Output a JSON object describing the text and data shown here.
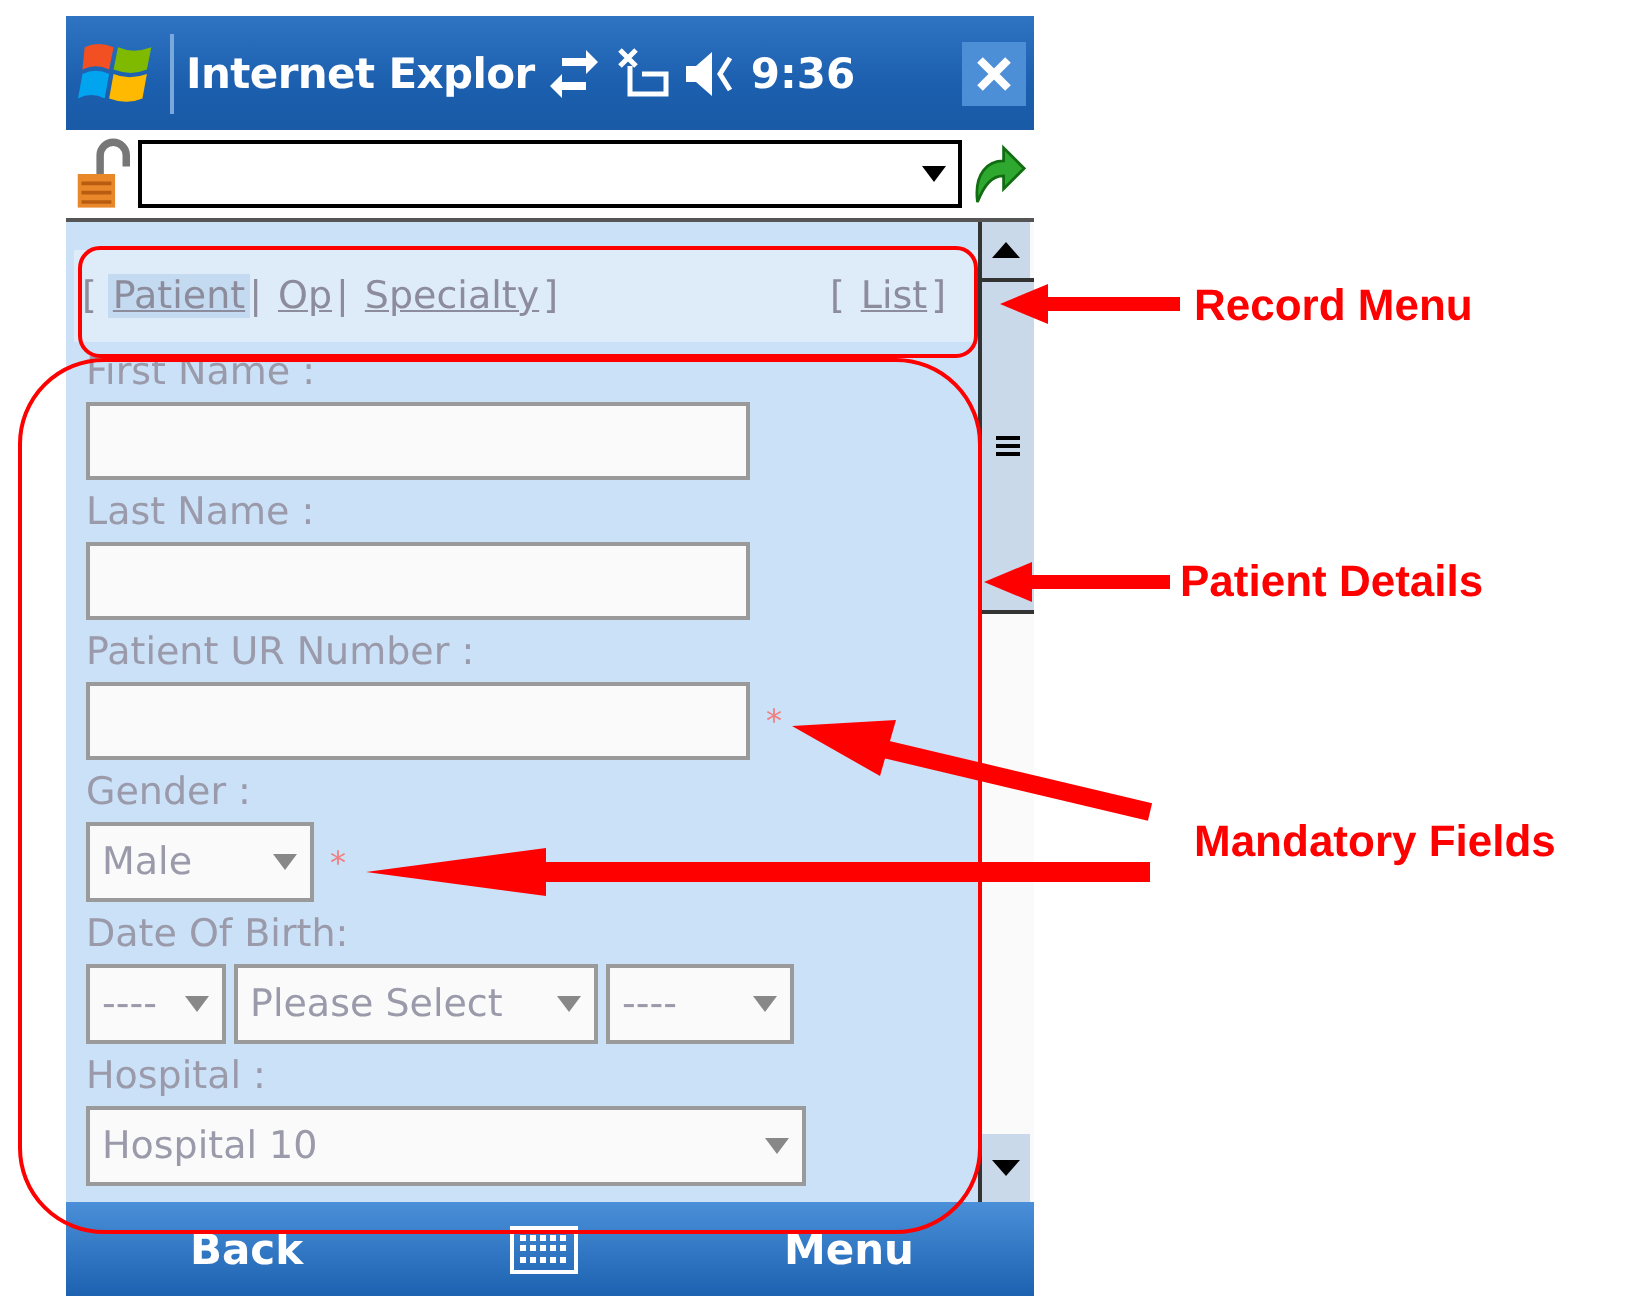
{
  "title_bar": {
    "title": "Internet Explor",
    "time": "9:36"
  },
  "record_menu": {
    "tabs": [
      {
        "text": "[",
        "kind": "mark"
      },
      {
        "text": "Patient",
        "kind": "link",
        "selected": true
      },
      {
        "text": "|",
        "kind": "mark"
      },
      {
        "text": "Op",
        "kind": "link",
        "selected": false
      },
      {
        "text": "|",
        "kind": "mark"
      },
      {
        "text": "Specialty",
        "kind": "link",
        "selected": false
      },
      {
        "text": "]",
        "kind": "mark"
      }
    ],
    "list": [
      {
        "text": "[",
        "kind": "mark"
      },
      {
        "text": "List",
        "kind": "link",
        "selected": false
      },
      {
        "text": "]",
        "kind": "mark"
      }
    ]
  },
  "fields": [
    {
      "label": "First Name :",
      "kind": "text"
    },
    {
      "label": "Last Name :",
      "kind": "text"
    },
    {
      "label": "Patient UR Number :",
      "kind": "text",
      "required_mark": "*"
    },
    {
      "label": "Gender :",
      "kind": "select",
      "required_mark": "*",
      "selects": [
        {
          "value": "Male"
        }
      ]
    },
    {
      "label": "Date Of Birth:",
      "kind": "select",
      "selects": [
        {
          "value": "----"
        },
        {
          "value": "Please Select"
        },
        {
          "value": "----"
        }
      ]
    },
    {
      "label": "Hospital :",
      "kind": "select",
      "selects": [
        {
          "value": "Hospital 10"
        }
      ]
    }
  ],
  "soft_keys": {
    "left": "Back",
    "right": "Menu"
  },
  "annotations": [
    {
      "text": "Record Menu",
      "kind": "record"
    },
    {
      "text": "Patient Details",
      "kind": "details"
    },
    {
      "text": "Mandatory Fields",
      "kind": "mandatory"
    }
  ]
}
